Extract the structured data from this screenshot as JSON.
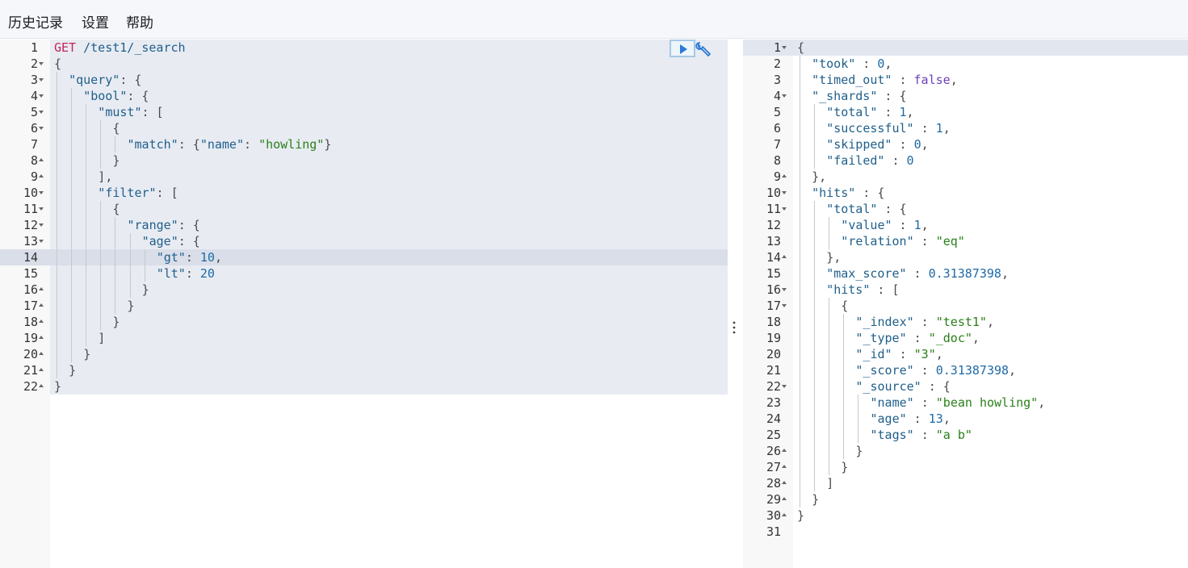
{
  "menu": {
    "history": "历史记录",
    "settings": "设置",
    "help": "帮助"
  },
  "icons": {
    "run": "play-icon",
    "settings": "wrench-icon",
    "resizer": "vertical-dots-icon"
  },
  "colors": {
    "key": "#1f5f8b",
    "string": "#298019",
    "number": "#1e6aa6",
    "boolean": "#6a3fb8",
    "method": "#c4255b"
  },
  "editor": {
    "active_line": 14,
    "lines": [
      {
        "n": "1",
        "fold": "",
        "indent": 0,
        "tokens": [
          [
            "method",
            "GET"
          ],
          [
            "plain",
            " "
          ],
          [
            "path",
            "/test1/_search"
          ]
        ]
      },
      {
        "n": "2",
        "fold": "open",
        "indent": 0,
        "tokens": [
          [
            "plain",
            "{"
          ]
        ]
      },
      {
        "n": "3",
        "fold": "open",
        "indent": 1,
        "tokens": [
          [
            "key",
            "\"query\""
          ],
          [
            "plain",
            ": {"
          ]
        ]
      },
      {
        "n": "4",
        "fold": "open",
        "indent": 2,
        "tokens": [
          [
            "key",
            "\"bool\""
          ],
          [
            "plain",
            ": {"
          ]
        ]
      },
      {
        "n": "5",
        "fold": "open",
        "indent": 3,
        "tokens": [
          [
            "key",
            "\"must\""
          ],
          [
            "plain",
            ": ["
          ]
        ]
      },
      {
        "n": "6",
        "fold": "open",
        "indent": 4,
        "tokens": [
          [
            "plain",
            "{"
          ]
        ]
      },
      {
        "n": "7",
        "fold": "",
        "indent": 5,
        "tokens": [
          [
            "key",
            "\"match\""
          ],
          [
            "plain",
            ": {"
          ],
          [
            "key",
            "\"name\""
          ],
          [
            "plain",
            ": "
          ],
          [
            "str",
            "\"howling\""
          ],
          [
            "plain",
            "}"
          ]
        ]
      },
      {
        "n": "8",
        "fold": "close",
        "indent": 4,
        "tokens": [
          [
            "plain",
            "}"
          ]
        ]
      },
      {
        "n": "9",
        "fold": "close",
        "indent": 3,
        "tokens": [
          [
            "plain",
            "],"
          ]
        ]
      },
      {
        "n": "10",
        "fold": "open",
        "indent": 3,
        "tokens": [
          [
            "key",
            "\"filter\""
          ],
          [
            "plain",
            ": ["
          ]
        ]
      },
      {
        "n": "11",
        "fold": "open",
        "indent": 4,
        "tokens": [
          [
            "plain",
            "{"
          ]
        ]
      },
      {
        "n": "12",
        "fold": "open",
        "indent": 5,
        "tokens": [
          [
            "key",
            "\"range\""
          ],
          [
            "plain",
            ": {"
          ]
        ]
      },
      {
        "n": "13",
        "fold": "open",
        "indent": 6,
        "tokens": [
          [
            "key",
            "\"age\""
          ],
          [
            "plain",
            ": {"
          ]
        ]
      },
      {
        "n": "14",
        "fold": "",
        "indent": 7,
        "tokens": [
          [
            "key",
            "\"gt\""
          ],
          [
            "plain",
            ": "
          ],
          [
            "num",
            "10"
          ],
          [
            "plain",
            ","
          ]
        ]
      },
      {
        "n": "15",
        "fold": "",
        "indent": 7,
        "tokens": [
          [
            "key",
            "\"lt\""
          ],
          [
            "plain",
            ": "
          ],
          [
            "num",
            "20"
          ]
        ]
      },
      {
        "n": "16",
        "fold": "close",
        "indent": 6,
        "tokens": [
          [
            "plain",
            "}"
          ]
        ]
      },
      {
        "n": "17",
        "fold": "close",
        "indent": 5,
        "tokens": [
          [
            "plain",
            "}"
          ]
        ]
      },
      {
        "n": "18",
        "fold": "close",
        "indent": 4,
        "tokens": [
          [
            "plain",
            "}"
          ]
        ]
      },
      {
        "n": "19",
        "fold": "close",
        "indent": 3,
        "tokens": [
          [
            "plain",
            "]"
          ]
        ]
      },
      {
        "n": "20",
        "fold": "close",
        "indent": 2,
        "tokens": [
          [
            "plain",
            "}"
          ]
        ]
      },
      {
        "n": "21",
        "fold": "close",
        "indent": 1,
        "tokens": [
          [
            "plain",
            "}"
          ]
        ]
      },
      {
        "n": "22",
        "fold": "close",
        "indent": 0,
        "tokens": [
          [
            "plain",
            "}"
          ]
        ]
      }
    ]
  },
  "output": {
    "lines": [
      {
        "n": "1",
        "fold": "open",
        "indent": 0,
        "tokens": [
          [
            "plain",
            "{"
          ]
        ]
      },
      {
        "n": "2",
        "fold": "",
        "indent": 1,
        "tokens": [
          [
            "key",
            "\"took\""
          ],
          [
            "plain",
            " : "
          ],
          [
            "num",
            "0"
          ],
          [
            "plain",
            ","
          ]
        ]
      },
      {
        "n": "3",
        "fold": "",
        "indent": 1,
        "tokens": [
          [
            "key",
            "\"timed_out\""
          ],
          [
            "plain",
            " : "
          ],
          [
            "bool",
            "false"
          ],
          [
            "plain",
            ","
          ]
        ]
      },
      {
        "n": "4",
        "fold": "open",
        "indent": 1,
        "tokens": [
          [
            "key",
            "\"_shards\""
          ],
          [
            "plain",
            " : {"
          ]
        ]
      },
      {
        "n": "5",
        "fold": "",
        "indent": 2,
        "tokens": [
          [
            "key",
            "\"total\""
          ],
          [
            "plain",
            " : "
          ],
          [
            "num",
            "1"
          ],
          [
            "plain",
            ","
          ]
        ]
      },
      {
        "n": "6",
        "fold": "",
        "indent": 2,
        "tokens": [
          [
            "key",
            "\"successful\""
          ],
          [
            "plain",
            " : "
          ],
          [
            "num",
            "1"
          ],
          [
            "plain",
            ","
          ]
        ]
      },
      {
        "n": "7",
        "fold": "",
        "indent": 2,
        "tokens": [
          [
            "key",
            "\"skipped\""
          ],
          [
            "plain",
            " : "
          ],
          [
            "num",
            "0"
          ],
          [
            "plain",
            ","
          ]
        ]
      },
      {
        "n": "8",
        "fold": "",
        "indent": 2,
        "tokens": [
          [
            "key",
            "\"failed\""
          ],
          [
            "plain",
            " : "
          ],
          [
            "num",
            "0"
          ]
        ]
      },
      {
        "n": "9",
        "fold": "close",
        "indent": 1,
        "tokens": [
          [
            "plain",
            "},"
          ]
        ]
      },
      {
        "n": "10",
        "fold": "open",
        "indent": 1,
        "tokens": [
          [
            "key",
            "\"hits\""
          ],
          [
            "plain",
            " : {"
          ]
        ]
      },
      {
        "n": "11",
        "fold": "open",
        "indent": 2,
        "tokens": [
          [
            "key",
            "\"total\""
          ],
          [
            "plain",
            " : {"
          ]
        ]
      },
      {
        "n": "12",
        "fold": "",
        "indent": 3,
        "tokens": [
          [
            "key",
            "\"value\""
          ],
          [
            "plain",
            " : "
          ],
          [
            "num",
            "1"
          ],
          [
            "plain",
            ","
          ]
        ]
      },
      {
        "n": "13",
        "fold": "",
        "indent": 3,
        "tokens": [
          [
            "key",
            "\"relation\""
          ],
          [
            "plain",
            " : "
          ],
          [
            "str",
            "\"eq\""
          ]
        ]
      },
      {
        "n": "14",
        "fold": "close",
        "indent": 2,
        "tokens": [
          [
            "plain",
            "},"
          ]
        ]
      },
      {
        "n": "15",
        "fold": "",
        "indent": 2,
        "tokens": [
          [
            "key",
            "\"max_score\""
          ],
          [
            "plain",
            " : "
          ],
          [
            "num",
            "0.31387398"
          ],
          [
            "plain",
            ","
          ]
        ]
      },
      {
        "n": "16",
        "fold": "open",
        "indent": 2,
        "tokens": [
          [
            "key",
            "\"hits\""
          ],
          [
            "plain",
            " : ["
          ]
        ]
      },
      {
        "n": "17",
        "fold": "open",
        "indent": 3,
        "tokens": [
          [
            "plain",
            "{"
          ]
        ]
      },
      {
        "n": "18",
        "fold": "",
        "indent": 4,
        "tokens": [
          [
            "key",
            "\"_index\""
          ],
          [
            "plain",
            " : "
          ],
          [
            "str",
            "\"test1\""
          ],
          [
            "plain",
            ","
          ]
        ]
      },
      {
        "n": "19",
        "fold": "",
        "indent": 4,
        "tokens": [
          [
            "key",
            "\"_type\""
          ],
          [
            "plain",
            " : "
          ],
          [
            "str",
            "\"_doc\""
          ],
          [
            "plain",
            ","
          ]
        ]
      },
      {
        "n": "20",
        "fold": "",
        "indent": 4,
        "tokens": [
          [
            "key",
            "\"_id\""
          ],
          [
            "plain",
            " : "
          ],
          [
            "str",
            "\"3\""
          ],
          [
            "plain",
            ","
          ]
        ]
      },
      {
        "n": "21",
        "fold": "",
        "indent": 4,
        "tokens": [
          [
            "key",
            "\"_score\""
          ],
          [
            "plain",
            " : "
          ],
          [
            "num",
            "0.31387398"
          ],
          [
            "plain",
            ","
          ]
        ]
      },
      {
        "n": "22",
        "fold": "open",
        "indent": 4,
        "tokens": [
          [
            "key",
            "\"_source\""
          ],
          [
            "plain",
            " : {"
          ]
        ]
      },
      {
        "n": "23",
        "fold": "",
        "indent": 5,
        "tokens": [
          [
            "key",
            "\"name\""
          ],
          [
            "plain",
            " : "
          ],
          [
            "str",
            "\"bean howling\""
          ],
          [
            "plain",
            ","
          ]
        ]
      },
      {
        "n": "24",
        "fold": "",
        "indent": 5,
        "tokens": [
          [
            "key",
            "\"age\""
          ],
          [
            "plain",
            " : "
          ],
          [
            "num",
            "13"
          ],
          [
            "plain",
            ","
          ]
        ]
      },
      {
        "n": "25",
        "fold": "",
        "indent": 5,
        "tokens": [
          [
            "key",
            "\"tags\""
          ],
          [
            "plain",
            " : "
          ],
          [
            "str",
            "\"a b\""
          ]
        ]
      },
      {
        "n": "26",
        "fold": "close",
        "indent": 4,
        "tokens": [
          [
            "plain",
            "}"
          ]
        ]
      },
      {
        "n": "27",
        "fold": "close",
        "indent": 3,
        "tokens": [
          [
            "plain",
            "}"
          ]
        ]
      },
      {
        "n": "28",
        "fold": "close",
        "indent": 2,
        "tokens": [
          [
            "plain",
            "]"
          ]
        ]
      },
      {
        "n": "29",
        "fold": "close",
        "indent": 1,
        "tokens": [
          [
            "plain",
            "}"
          ]
        ]
      },
      {
        "n": "30",
        "fold": "close",
        "indent": 0,
        "tokens": [
          [
            "plain",
            "}"
          ]
        ]
      },
      {
        "n": "31",
        "fold": "",
        "indent": 0,
        "tokens": []
      }
    ]
  }
}
